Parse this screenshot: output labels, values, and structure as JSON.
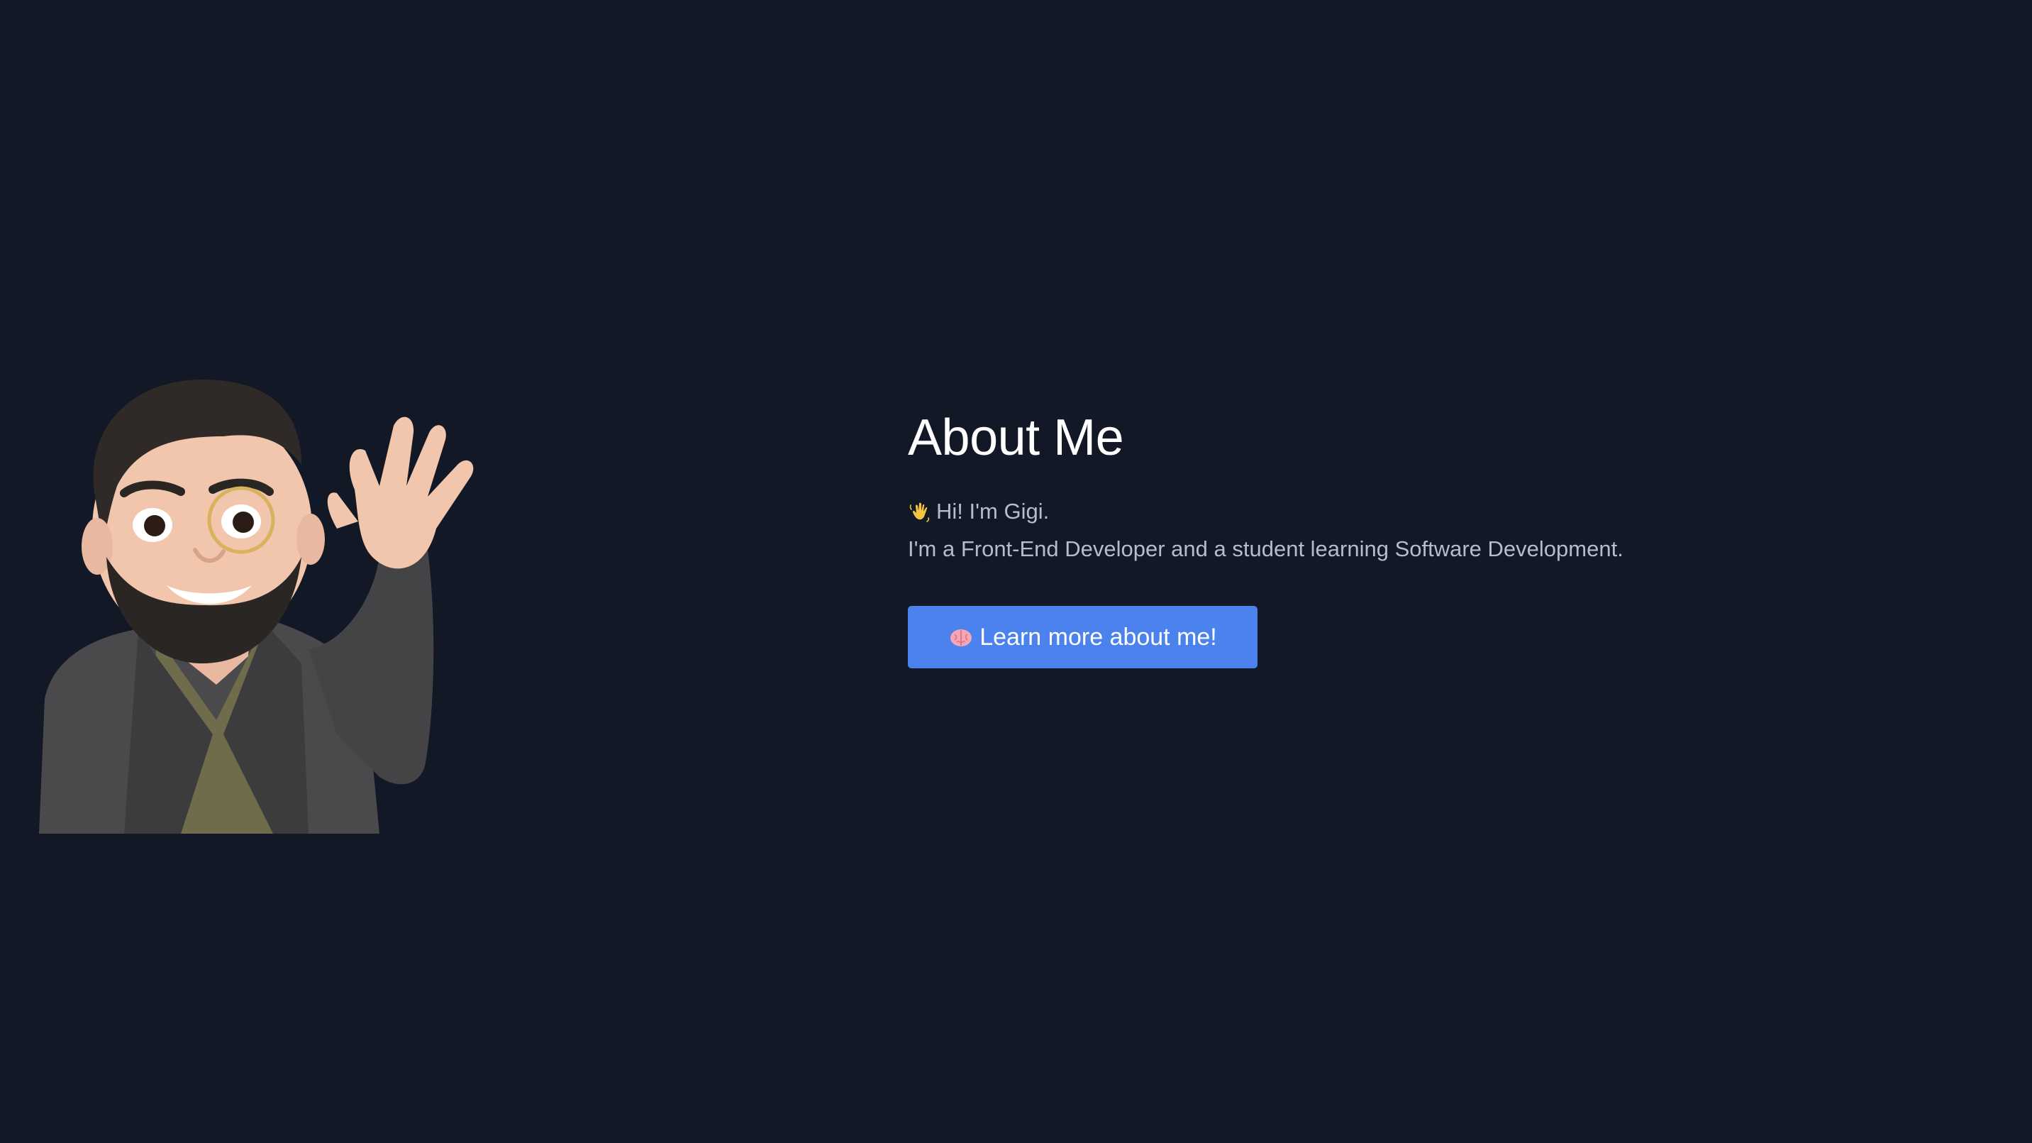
{
  "about": {
    "title": "About Me",
    "greeting": "Hi! I'm Gigi.",
    "description": "I'm a Front-End Developer and a student learning Software Development.",
    "greeting_icon": "waving-hand-icon"
  },
  "cta": {
    "label": "Learn more about me!",
    "icon": "brain-icon"
  },
  "colors": {
    "background": "#121826",
    "button": "#4b82ee",
    "title": "#ffffff",
    "body_text": "#b6bcc8"
  }
}
